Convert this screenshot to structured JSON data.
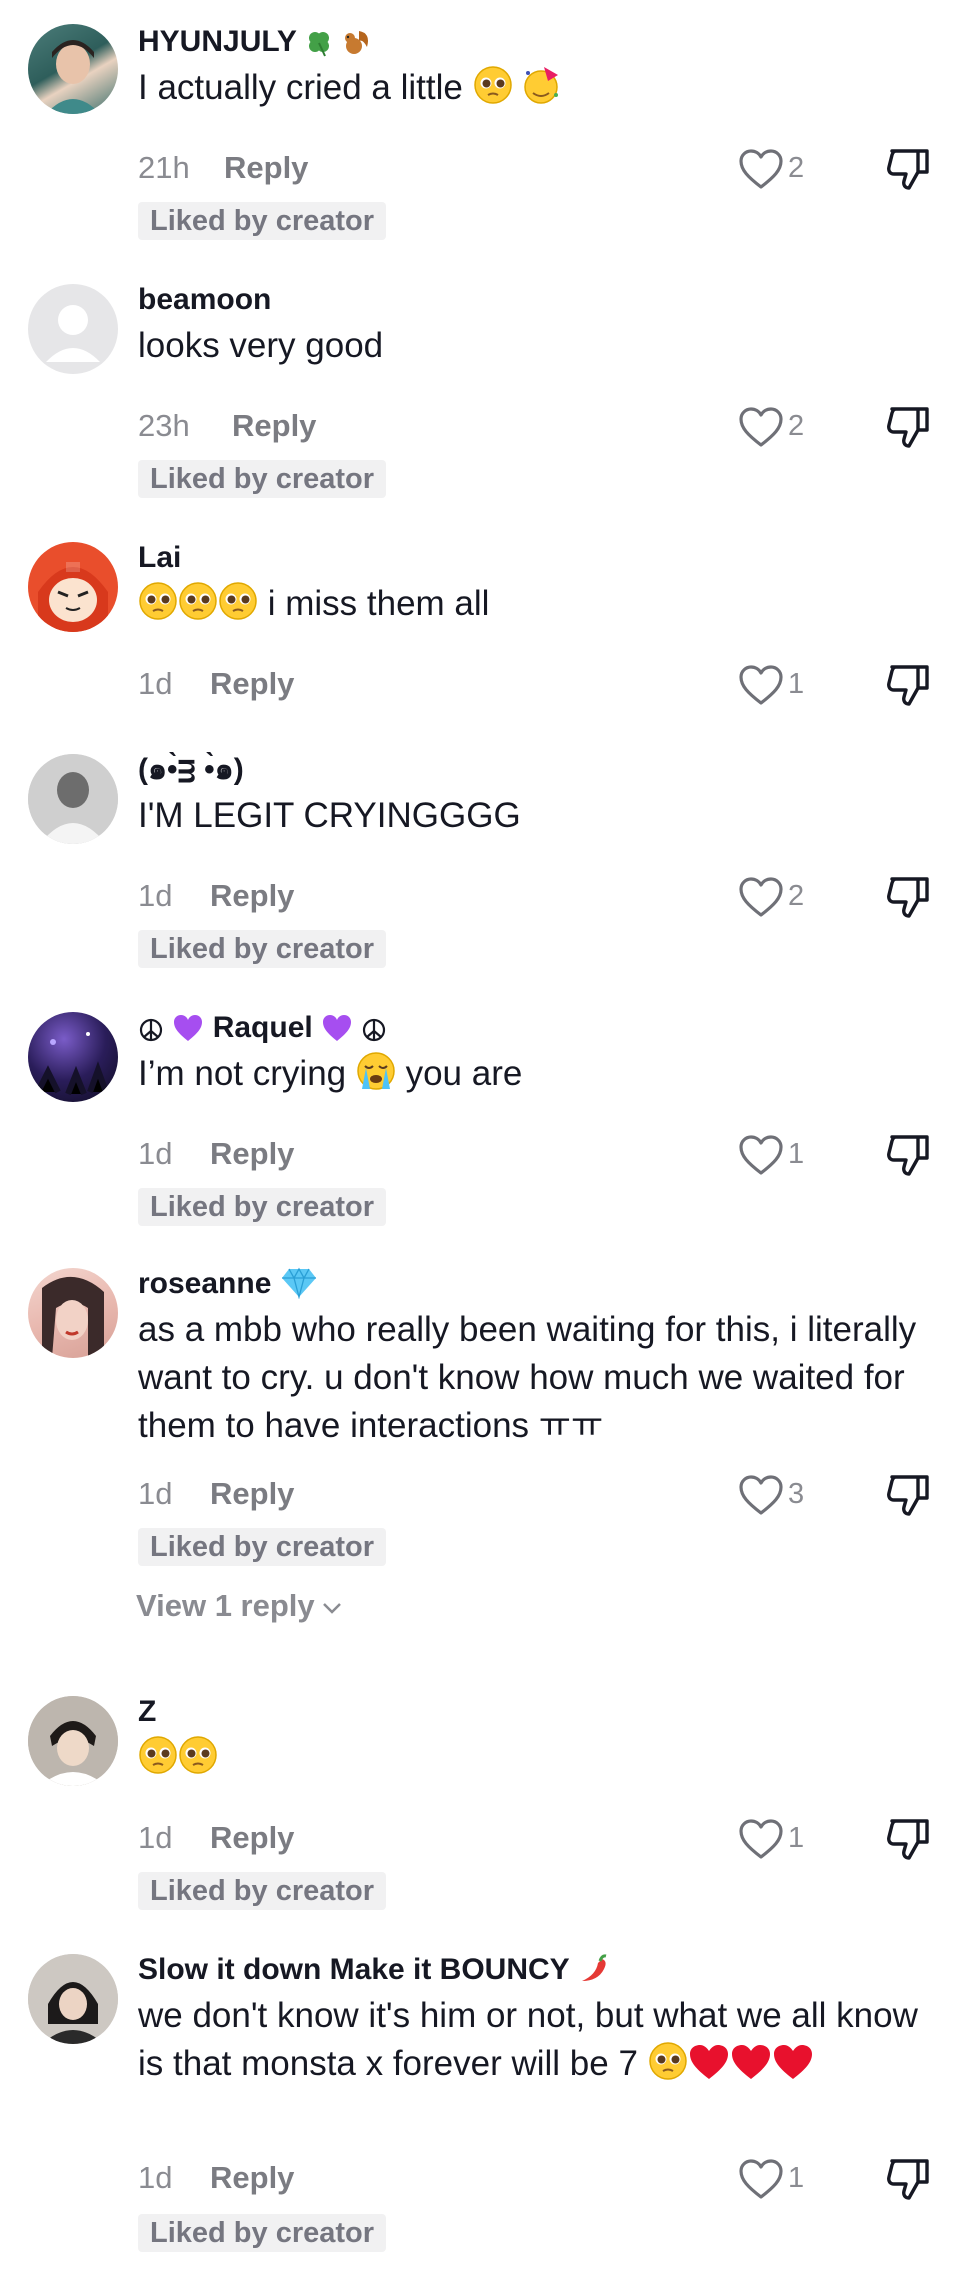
{
  "comments": [
    {
      "username": "HYUNJULY",
      "text": "I actually cried a little",
      "time": "21h",
      "reply": "Reply",
      "likes": "2",
      "badge": "Liked by creator"
    },
    {
      "username": "beamoon",
      "text": "looks very good",
      "time": "23h",
      "reply": "Reply",
      "likes": "2",
      "badge": "Liked by creator"
    },
    {
      "username": "Lai",
      "text": "i miss them all",
      "time": "1d",
      "reply": "Reply",
      "likes": "1"
    },
    {
      "username": "(๑•̀ᴟ •̀๑)",
      "text": "I'M LEGIT CRYINGGGG",
      "time": "1d",
      "reply": "Reply",
      "likes": "2",
      "badge": "Liked by creator"
    },
    {
      "username": "Raquel",
      "text_before": "I’m not crying",
      "text_after": "you are",
      "time": "1d",
      "reply": "Reply",
      "likes": "1",
      "badge": "Liked by creator"
    },
    {
      "username": "roseanne",
      "text": "as a mbb who really been waiting for this, i literally want to cry. u don't know how much we waited for them to have interactions ㅠㅠ",
      "time": "1d",
      "reply": "Reply",
      "likes": "3",
      "badge": "Liked by creator",
      "view_replies": "View 1 reply"
    },
    {
      "username": "Z",
      "time": "1d",
      "reply": "Reply",
      "likes": "1",
      "badge": "Liked by creator"
    },
    {
      "username": "Slow it down Make it BOUNCY",
      "text": "we don't know it's him or not, but what we all know is that monsta x forever will be 7",
      "time": "1d",
      "reply": "Reply",
      "likes": "1",
      "badge": "Liked by creator"
    }
  ],
  "icons": {
    "like": "heart-outline-icon",
    "dislike": "thumbs-down-icon",
    "emoji_pleading": "pleading-face-emoji",
    "emoji_crying": "loudly-crying-face-emoji",
    "emoji_party": "partying-face-emoji",
    "emoji_heart": "red-heart-emoji"
  },
  "colors": {
    "text": "#161823",
    "muted": "#8a8b91",
    "badge_bg": "#f1f1f2"
  }
}
